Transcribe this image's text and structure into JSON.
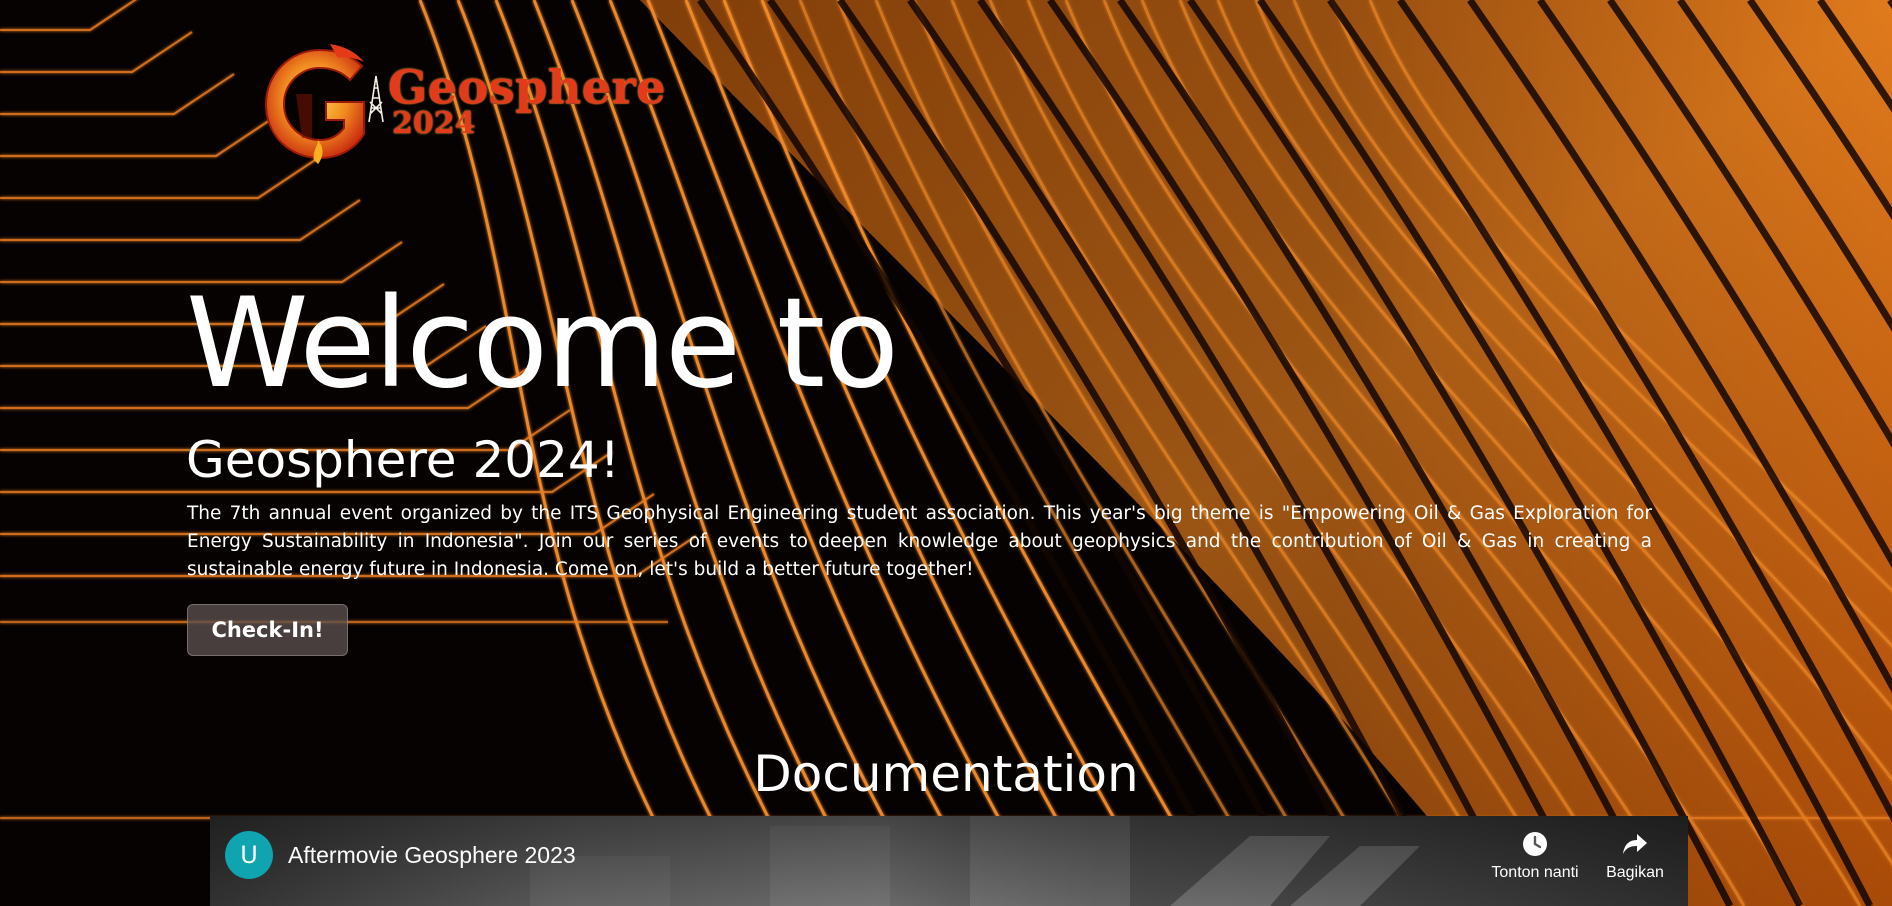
{
  "logo": {
    "name": "Geosphere",
    "year": "2024",
    "brand_color": "#e33a1a"
  },
  "hero": {
    "title": "Welcome to",
    "subtitle": "Geosphere 2024!",
    "description": "The 7th annual event organized by the ITS Geophysical Engineering student association. This year's big theme is \"Empowering Oil & Gas Exploration for Energy Sustainability in Indonesia\". Join our series of events to deepen knowledge about geophysics and the contribution of Oil & Gas in creating a sustainable energy future in Indonesia. Come on, let's build a better future together!",
    "checkin_label": "Check-In!"
  },
  "documentation": {
    "title": "Documentation",
    "video": {
      "channel_initial": "U",
      "title": "Aftermovie Geosphere 2023",
      "watch_later_label": "Tonton nanti",
      "share_label": "Bagikan",
      "watch_later_icon": "clock-icon",
      "share_icon": "share-arrow-icon"
    }
  },
  "colors": {
    "accent_orange": "#e8761a",
    "avatar_teal": "#10a3b0",
    "background": "#000000"
  }
}
